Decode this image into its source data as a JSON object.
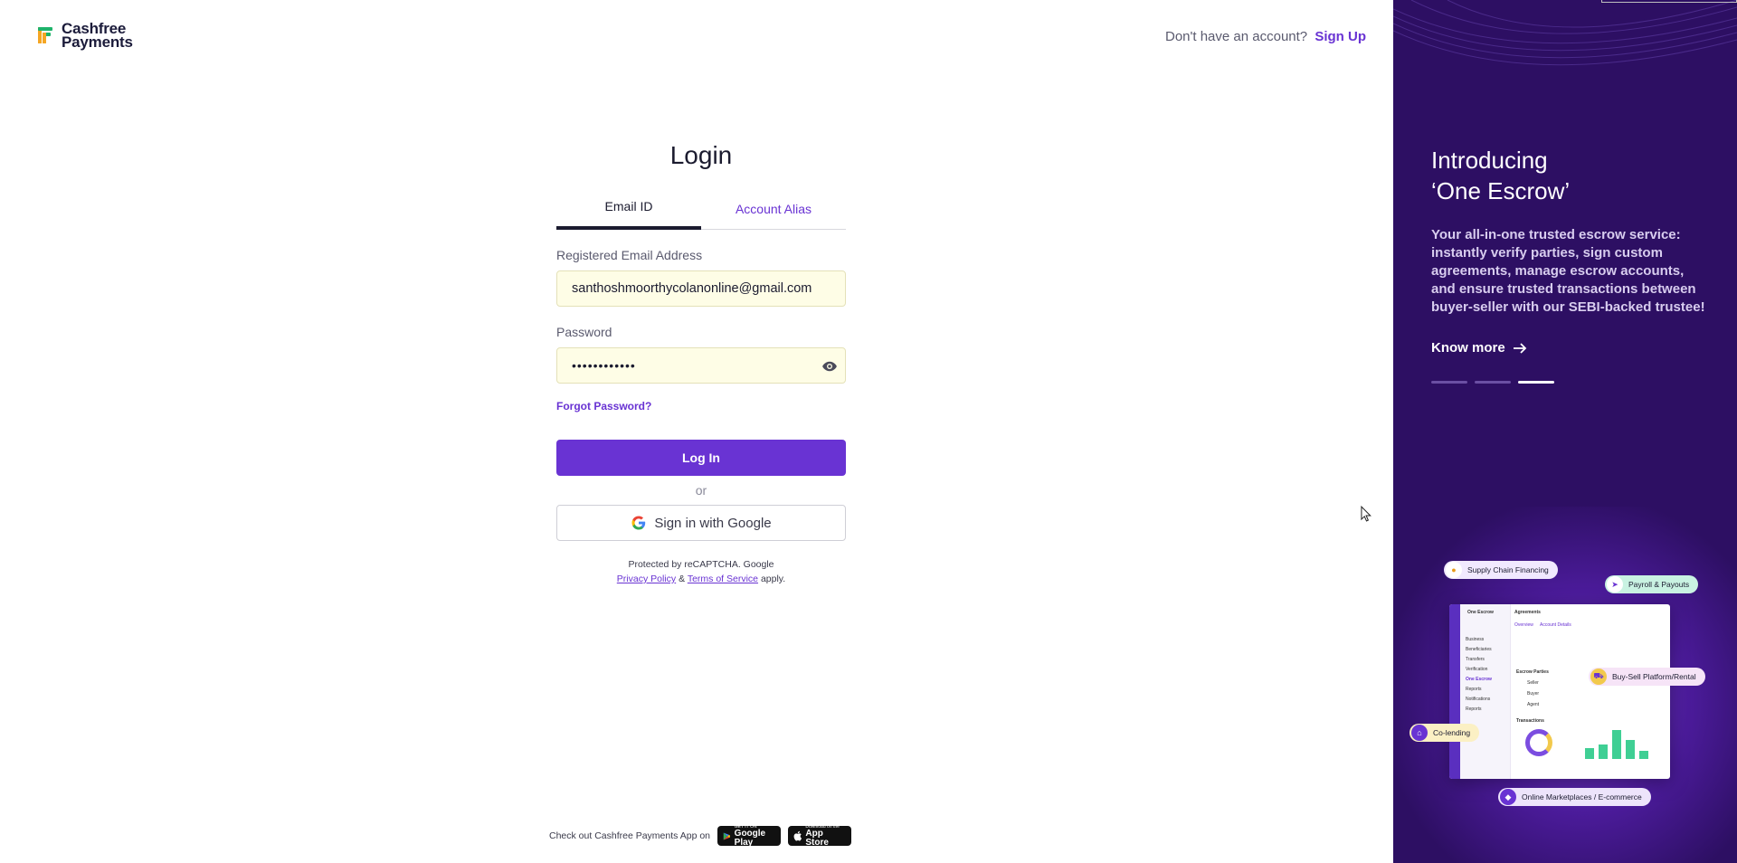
{
  "brand": {
    "line1": "Cashfree",
    "line2": "Payments",
    "logo_icon": "cashfree-logo-icon"
  },
  "header": {
    "prompt": "Don't have an account?",
    "signup_label": "Sign Up"
  },
  "login": {
    "title": "Login",
    "tabs": [
      {
        "label": "Email ID",
        "active": true
      },
      {
        "label": "Account Alias",
        "active": false
      }
    ],
    "email_label": "Registered Email Address",
    "email_value": "santhoshmoorthycolanonline@gmail.com",
    "password_label": "Password",
    "password_value": "••••••••••••",
    "forgot_label": "Forgot Password?",
    "login_button": "Log In",
    "or_text": "or",
    "google_button": "Sign in with Google",
    "recaptcha_prefix": "Protected by reCAPTCHA. Google",
    "privacy_link": "Privacy Policy",
    "and_text": "&",
    "terms_link": "Terms of Service",
    "apply_text": "apply."
  },
  "footer": {
    "app_text": "Check out Cashfree Payments App on",
    "google_play_small": "GET IT ON",
    "google_play": "Google Play",
    "app_store_small": "Download on the",
    "app_store": "App Store"
  },
  "promo": {
    "title_line1": "Introducing",
    "title_line2": "‘One Escrow’",
    "description": "Your all-in-one trusted escrow service: instantly verify parties, sign custom agreements, manage escrow accounts, and ensure trusted transactions between buyer-seller with our SEBI-backed trustee!",
    "cta": "Know more",
    "slides_total": 3,
    "slide_active": 3,
    "chips": [
      "Supply Chain Financing",
      "Payroll & Payouts",
      "Buy-Sell Platform/Rental",
      "Co-lending",
      "Online Marketplaces / E-commerce"
    ],
    "mock": {
      "app_name": "One Escrow",
      "page": "Agreements",
      "tabs": [
        "Overview",
        "Account Details"
      ],
      "nav": [
        "Business",
        "Beneficiaries",
        "Transfers",
        "Verification",
        "One Escrow",
        "Reports",
        "Notifications",
        "Reports"
      ],
      "parties_title": "Escrow Parties",
      "parties": [
        "Seller",
        "Buyer",
        "Agent"
      ],
      "chart_title": "Transactions",
      "chart_values": [
        0.25,
        0.35,
        0.7,
        0.45,
        0.2
      ]
    }
  },
  "colors": {
    "accent": "#6933d3",
    "promo_bg": "#2d0f63",
    "input_bg": "#fefde6"
  }
}
